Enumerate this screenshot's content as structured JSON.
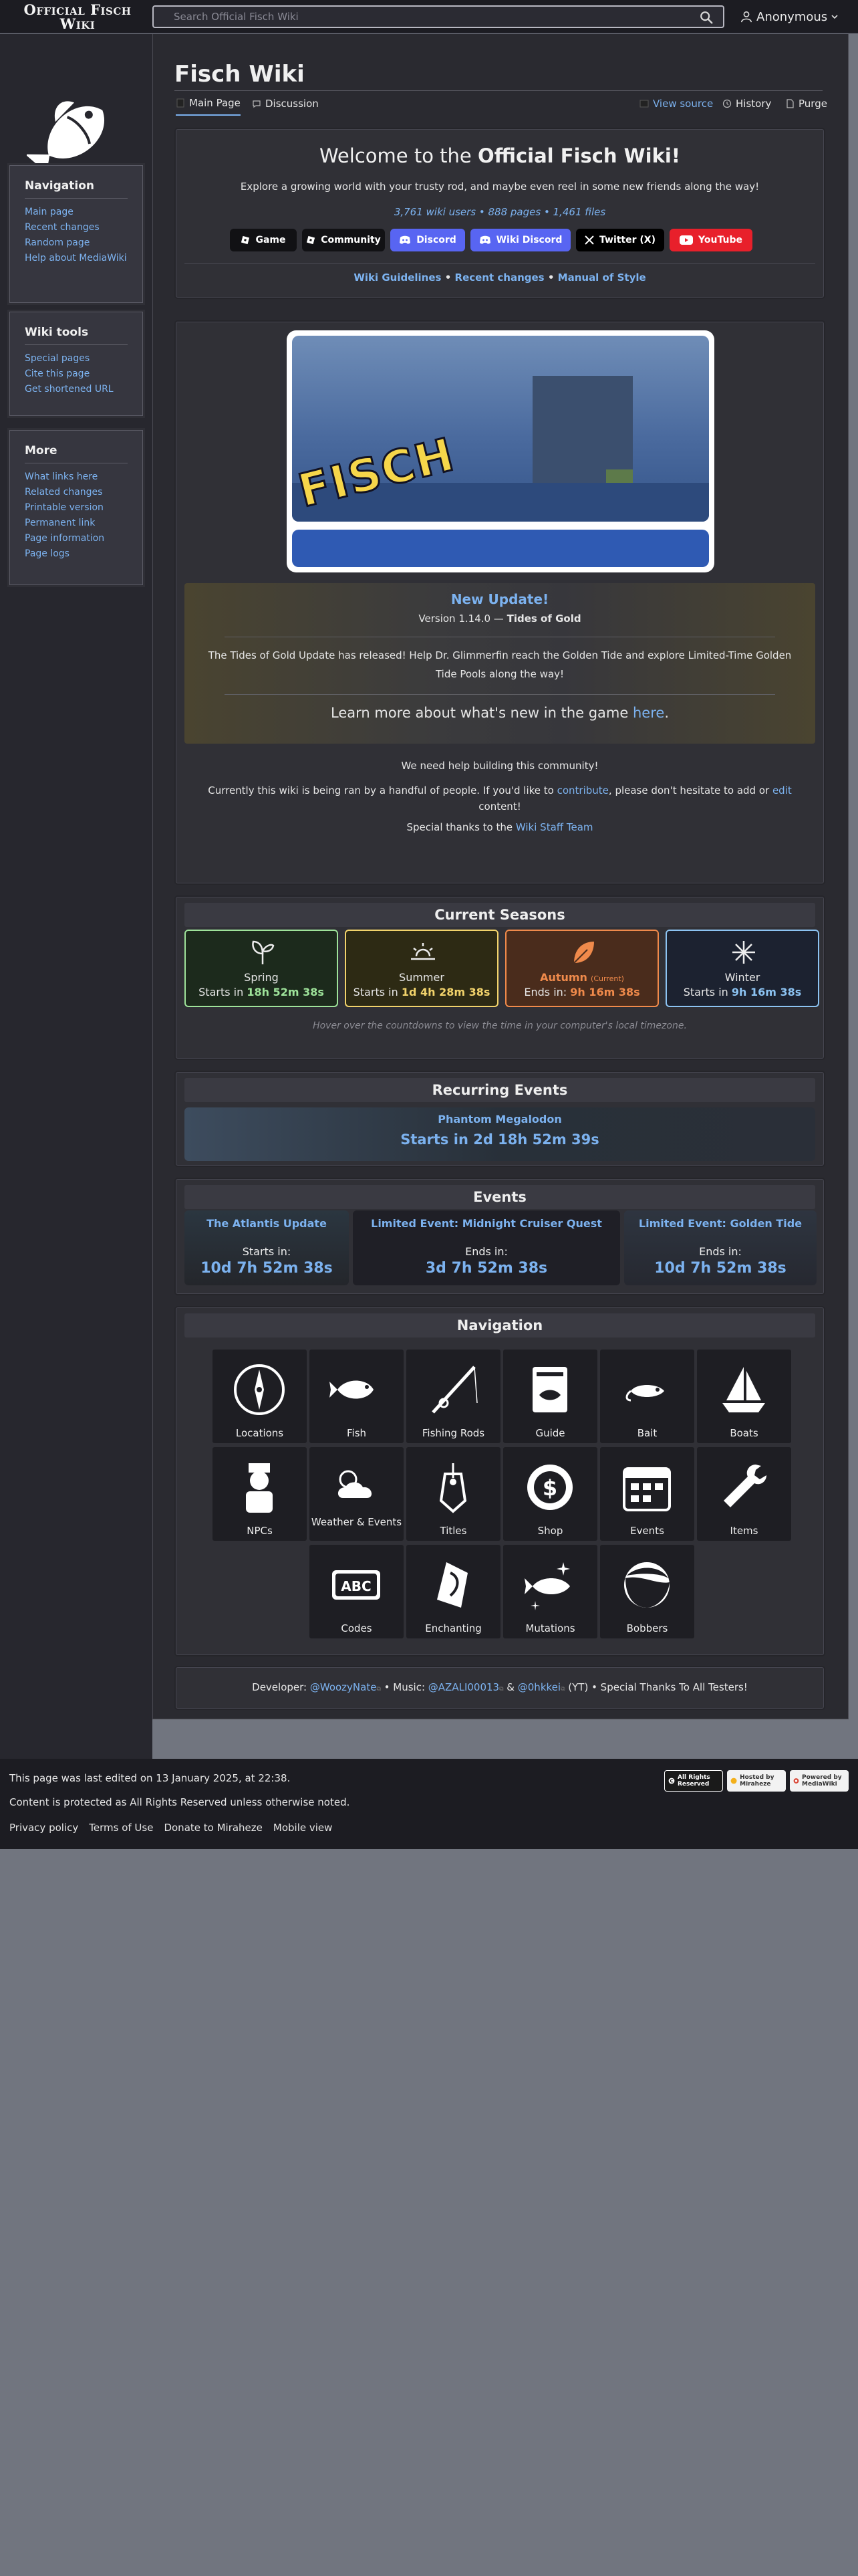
{
  "header": {
    "logo_text": "Official Fisch Wiki",
    "search_placeholder": "Search Official Fisch Wiki",
    "user_label": "Anonymous"
  },
  "sidebar": {
    "navigation": {
      "title": "Navigation",
      "items": [
        "Main page",
        "Recent changes",
        "Random page",
        "Help about MediaWiki"
      ]
    },
    "tools": {
      "title": "Wiki tools",
      "items": [
        "Special pages",
        "Cite this page",
        "Get shortened URL"
      ]
    },
    "more": {
      "title": "More",
      "items": [
        "What links here",
        "Related changes",
        "Printable version",
        "Permanent link",
        "Page information",
        "Page logs"
      ]
    }
  },
  "page": {
    "title": "Fisch Wiki",
    "tabs": [
      "Main Page",
      "Discussion"
    ],
    "actions": [
      "View source",
      "History",
      "Purge"
    ]
  },
  "welcome": {
    "heading_pre": "Welcome to the ",
    "heading_bold": "Official Fisch Wiki!",
    "subtitle": "Explore a growing world with your trusty rod, and maybe even reel in some new friends along the way!",
    "stats": "3,761 wiki users • 888 pages • 1,461 files",
    "buttons": [
      {
        "label": "Game",
        "color": "#111114"
      },
      {
        "label": "Community",
        "color": "#111114"
      },
      {
        "label": "Discord",
        "color": "#5865f2"
      },
      {
        "label": "Wiki Discord",
        "color": "#5865f2"
      },
      {
        "label": "Twitter (X)",
        "color": "#000000"
      },
      {
        "label": "YouTube",
        "color": "#e8202b"
      }
    ],
    "guidelines": [
      "Wiki Guidelines",
      "Recent changes",
      "Manual of Style"
    ],
    "separator": "•"
  },
  "update": {
    "banner_text": "FISCH",
    "title": "New Update!",
    "version_pre": "Version 1.14.0 — ",
    "version_name": "Tides of Gold",
    "description": "The Tides of Gold Update has released! Help Dr. Glimmerfin reach the Golden Tide and explore Limited-Time Golden Tide Pools along the way!",
    "learn_pre": "Learn more about what's new in the game ",
    "learn_link": "here",
    "learn_post": ".",
    "help_text": "We need help building this community!",
    "ran_pre": "Currently this wiki is being ran by a handful of people. If you'd like to ",
    "ran_link1": "contribute",
    "ran_mid": ", please don't hesitate to add or ",
    "ran_link2": "edit",
    "ran_post": " content!",
    "thanks_pre": "Special thanks to the ",
    "thanks_link": "Wiki Staff Team"
  },
  "seasons": {
    "title": "Current Seasons",
    "items": [
      {
        "name": "Spring",
        "label": "Starts in ",
        "time": "18h 52m 38s",
        "color": "#9ee39a",
        "icon": "sprout-icon"
      },
      {
        "name": "Summer",
        "label": "Starts in ",
        "time": "1d 4h 28m 38s",
        "color": "#f2d36b",
        "icon": "sunset-icon"
      },
      {
        "name": "Autumn",
        "tag": "(Current)",
        "label": "Ends in: ",
        "time": "9h 16m 38s",
        "color": "#f08a4b",
        "icon": "leaf-icon"
      },
      {
        "name": "Winter",
        "label": "Starts in ",
        "time": "9h 16m 38s",
        "color": "#8cc3f2",
        "icon": "snowflake-icon"
      }
    ],
    "note": "Hover over the countdowns to view the time in your computer's local timezone."
  },
  "recurring": {
    "title": "Recurring Events",
    "name": "Phantom Megalodon",
    "time": "Starts in 2d 18h 52m 39s"
  },
  "events": {
    "title": "Events",
    "items": [
      {
        "name": "The Atlantis Update",
        "label": "Starts in:",
        "time": "10d 7h 52m 38s"
      },
      {
        "name": "Limited Event: Midnight Cruiser Quest",
        "label": "Ends in:",
        "time": "3d 7h 52m 38s"
      },
      {
        "name": "Limited Event: Golden Tide",
        "label": "Ends in:",
        "time": "10d 7h 52m 38s"
      }
    ]
  },
  "navigation": {
    "title": "Navigation",
    "tiles": [
      {
        "label": "Locations",
        "icon": "compass-icon"
      },
      {
        "label": "Fish",
        "icon": "fish-icon"
      },
      {
        "label": "Fishing Rods",
        "icon": "fishing-rod-icon"
      },
      {
        "label": "Guide",
        "icon": "guide-book-icon"
      },
      {
        "label": "Bait",
        "icon": "bait-icon"
      },
      {
        "label": "Boats",
        "icon": "boat-icon"
      },
      {
        "label": "NPCs",
        "icon": "npc-icon"
      },
      {
        "label": "Weather & Events",
        "icon": "weather-icon"
      },
      {
        "label": "Titles",
        "icon": "tag-icon"
      },
      {
        "label": "Shop",
        "icon": "coin-icon"
      },
      {
        "label": "Events",
        "icon": "calendar-icon"
      },
      {
        "label": "Items",
        "icon": "wrench-icon"
      },
      {
        "label": "Codes",
        "icon": "abc-icon"
      },
      {
        "label": "Enchanting",
        "icon": "enchant-icon"
      },
      {
        "label": "Mutations",
        "icon": "mutation-fish-icon"
      },
      {
        "label": "Bobbers",
        "icon": "bobber-icon"
      }
    ]
  },
  "credits": {
    "dev_label": "Developer: ",
    "dev_name": "@WoozyNate",
    "music_label": " • Music: ",
    "music1": "@AZALI00013",
    "amp": " & ",
    "music2": "@0hkkei",
    "yt": " (YT) • Special Thanks To All Testers!"
  },
  "footer": {
    "edited": "This page was last edited on 13 January 2025, at 22:38.",
    "protected": "Content is protected as All Rights Reserved unless otherwise noted.",
    "links": [
      "Privacy policy",
      "Terms of Use",
      "Donate to Miraheze",
      "Mobile view"
    ],
    "badges": [
      "All Rights Reserved",
      "Hosted by Miraheze",
      "Powered by MediaWiki"
    ]
  }
}
